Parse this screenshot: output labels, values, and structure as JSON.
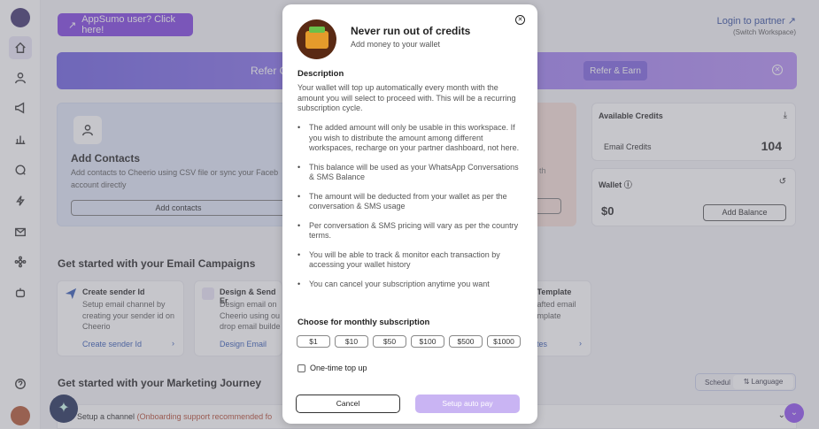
{
  "header": {
    "appsumo_label": "AppSumo user? Click here!",
    "login_partner": "Login to partner",
    "switch_workspace": "(Switch Workspace)"
  },
  "banner": {
    "text": "Refer Cl",
    "button": "Refer & Earn"
  },
  "contacts_card": {
    "title": "Add Contacts",
    "description": "Add contacts to Cheerio using CSV file or sync your Faceb account directly",
    "button": "Add contacts"
  },
  "peach_card": {
    "text": "th"
  },
  "credits": {
    "title": "Available Credits",
    "email_label": "Email Credits",
    "email_value": "104"
  },
  "wallet": {
    "title": "Wallet",
    "value": "$0",
    "button": "Add Balance"
  },
  "email_section": {
    "title": "Get started with your Email Campaigns",
    "cards": [
      {
        "title": "Create sender Id",
        "description": "Setup email channel by creating your sender id on Cheerio",
        "link": "Create sender Id"
      },
      {
        "title": "Design & Send Er",
        "description": "Design email on Cheerio using ou drop email builde",
        "link": "Design Email"
      },
      {
        "title": "il Template",
        "description": "crafted email template",
        "link": "lates"
      }
    ]
  },
  "marketing_section": {
    "title": "Get started with your Marketing Journey",
    "toggle_a": "Schedul",
    "toggle_b": "Language"
  },
  "setup_bar": {
    "text": "Setup a channel",
    "highlight": "(Onboarding support recommended fo"
  },
  "modal": {
    "title": "Never run out of credits",
    "subtitle": "Add money to your wallet",
    "desc_heading": "Description",
    "desc": "Your wallet will top up automatically every month with the amount you will select to proceed with. This will be a recurring subscription cycle.",
    "bullets": [
      "The added amount will only be usable in this workspace. If you wish to distribute the amount among different workspaces, recharge on your partner dashboard, not here.",
      "This balance will be used as your WhatsApp Conversations & SMS Balance",
      "The amount will be deducted from your wallet as per the conversation & SMS usage",
      "Per conversation & SMS pricing will vary as per the country terms.",
      "You will be able to track & monitor each transaction by accessing your wallet history",
      "You can cancel your subscription anytime you want"
    ],
    "choose_heading": "Choose for monthly subscription",
    "amounts": [
      "$1",
      "$10",
      "$50",
      "$100",
      "$500",
      "$1000"
    ],
    "one_time": "One-time top up",
    "cancel": "Cancel",
    "setup": "Setup auto pay"
  }
}
